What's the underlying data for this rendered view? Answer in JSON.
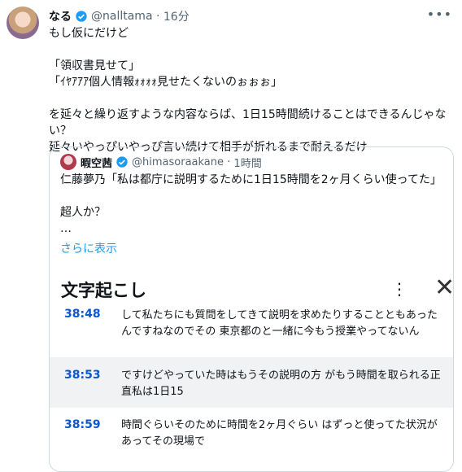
{
  "tweet": {
    "author_name": "なる",
    "handle": "@nalltama",
    "time": "16分",
    "text": "もし仮にだけど\n\n「領収書見せて」\n「ｲﾔｱｱｱ個人情報ｫｫｫｫ見せたくないのぉぉぉ」\n\nを延々と繰り返すような内容ならば、1日15時間続けることはできるんじゃない？\n延々いやっぴいやっぴ言い続けて相手が折れるまで耐えるだけ"
  },
  "quote": {
    "author_name": "暇空茜",
    "handle": "@himasoraakane",
    "time": "1時間",
    "text": "仁藤夢乃「私は都庁に説明するために1日15時間を2ヶ月くらい使ってた」\n\n超人か？\n…",
    "show_more": "さらに表示"
  },
  "transcript": {
    "title": "文字起こし",
    "more_icon": "⋮",
    "close_icon": "✕",
    "segments": [
      {
        "time": "38:48",
        "text": "して私たちにも質問をしてきて説明を求めたりすることともあったんですねなのでその 東京都のと一緒に今もう授業やってないん",
        "active": false
      },
      {
        "time": "38:53",
        "text": "ですけどやっていた時はもうその説明の方 がもう時間を取られる正直私は1日15",
        "active": true
      },
      {
        "time": "38:59",
        "text": "時間ぐらいそのために時間を2ヶ月ぐらい はずっと使ってた状況があってその現場で",
        "active": false
      }
    ]
  }
}
